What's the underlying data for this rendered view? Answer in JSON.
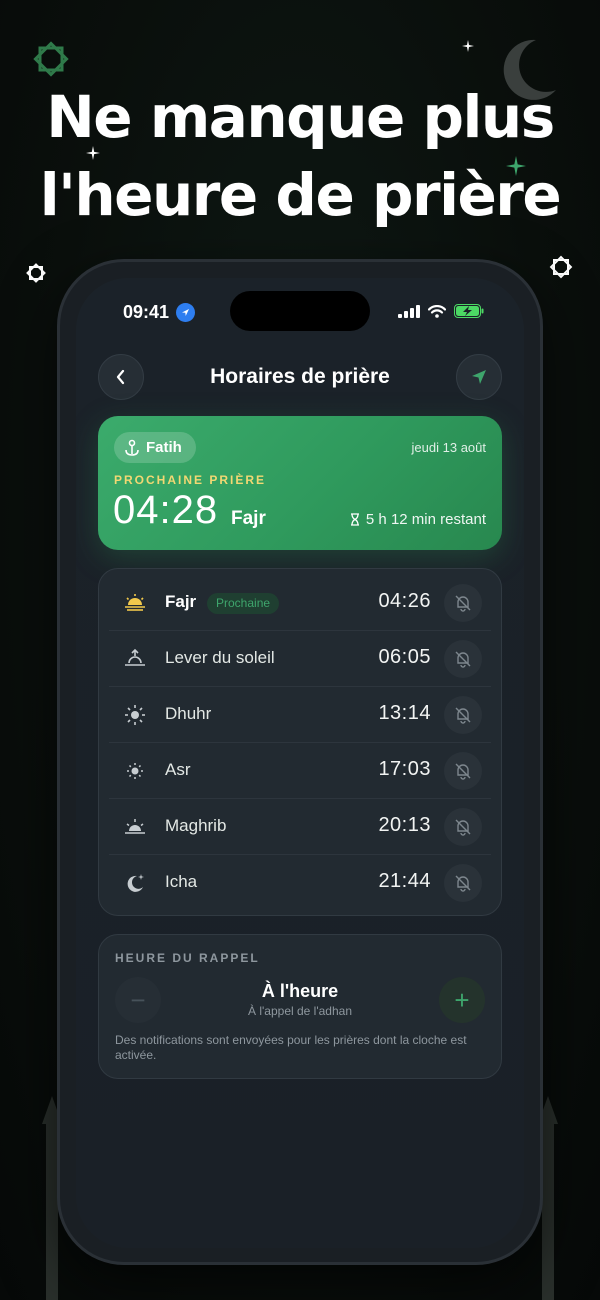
{
  "headline": {
    "line1": "Ne manque plus",
    "line2": "l'heure de prière"
  },
  "status_bar": {
    "time": "09:41"
  },
  "nav": {
    "title": "Horaires de prière"
  },
  "hero": {
    "location": "Fatih",
    "date": "jeudi 13 août",
    "label": "PROCHAINE PRIÈRE",
    "time": "04:28",
    "prayer": "Fajr",
    "remaining": "5 h 12 min restant"
  },
  "prayers": [
    {
      "name": "Fajr",
      "time": "04:26",
      "badge": "Prochaine",
      "icon": "sunrise-horizon-icon"
    },
    {
      "name": "Lever du soleil",
      "time": "06:05",
      "icon": "sunrise-icon"
    },
    {
      "name": "Dhuhr",
      "time": "13:14",
      "icon": "sun-icon"
    },
    {
      "name": "Asr",
      "time": "17:03",
      "icon": "sun-small-icon"
    },
    {
      "name": "Maghrib",
      "time": "20:13",
      "icon": "sunset-icon"
    },
    {
      "name": "Icha",
      "time": "21:44",
      "icon": "moon-stars-icon"
    }
  ],
  "reminder": {
    "label": "HEURE DU RAPPEL",
    "value": "À l'heure",
    "subtitle": "À l'appel de l'adhan",
    "note": "Des notifications sont envoyées pour les prières dont la cloche est activée.",
    "minus": "−",
    "plus": "+"
  },
  "colors": {
    "accent": "#3ea56c",
    "hero_gradient_start": "#3bab6c",
    "gold": "#f2d873",
    "background": "#0a0f0c"
  }
}
